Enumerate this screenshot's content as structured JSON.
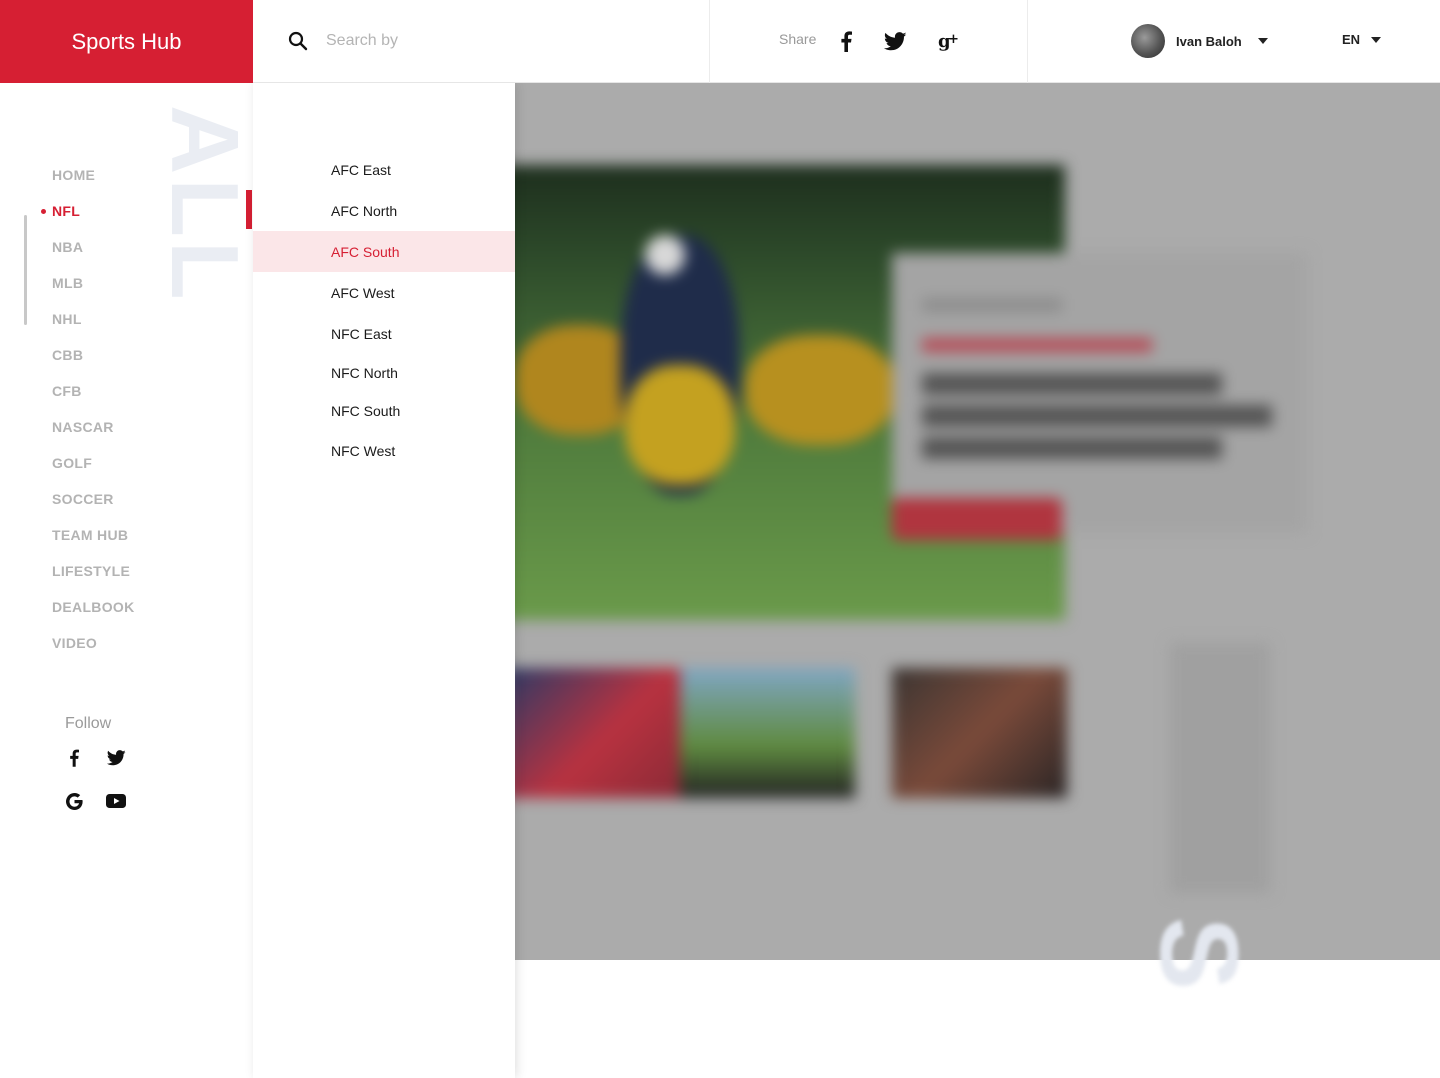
{
  "app": {
    "title": "Sports Hub"
  },
  "search": {
    "placeholder": "Search by"
  },
  "share": {
    "label": "Share",
    "icons": [
      "facebook-icon",
      "twitter-icon",
      "google-plus-icon"
    ]
  },
  "user": {
    "name": "Ivan Baloh"
  },
  "language": {
    "selected": "EN"
  },
  "sidebar": {
    "vertical_word": "ALL",
    "items": [
      {
        "label": "HOME",
        "active": false
      },
      {
        "label": "NFL",
        "active": true
      },
      {
        "label": "NBA",
        "active": false
      },
      {
        "label": "MLB",
        "active": false
      },
      {
        "label": "NHL",
        "active": false
      },
      {
        "label": "CBB",
        "active": false
      },
      {
        "label": "CFB",
        "active": false
      },
      {
        "label": "NASCAR",
        "active": false
      },
      {
        "label": "GOLF",
        "active": false
      },
      {
        "label": "SOCCER",
        "active": false
      },
      {
        "label": "TEAM HUB",
        "active": false
      },
      {
        "label": "LIFESTYLE",
        "active": false
      },
      {
        "label": "DEALBOOK",
        "active": false
      },
      {
        "label": "VIDEO",
        "active": false
      }
    ],
    "follow": {
      "label": "Follow",
      "icons": [
        "facebook-icon",
        "twitter-icon",
        "google-icon",
        "youtube-icon"
      ]
    }
  },
  "submenu": {
    "items": [
      {
        "label": "AFC East",
        "highlighted": false
      },
      {
        "label": "AFC North",
        "highlighted": false
      },
      {
        "label": "AFC South",
        "highlighted": true
      },
      {
        "label": "AFC West",
        "highlighted": false
      },
      {
        "label": "NFC East",
        "highlighted": false
      },
      {
        "label": "NFC North",
        "highlighted": false
      },
      {
        "label": "NFC South",
        "highlighted": false
      },
      {
        "label": "NFC West",
        "highlighted": false
      }
    ]
  },
  "colors": {
    "brand_red": "#d61f33",
    "highlight_bg": "#fbe6e8",
    "overlay_gray": "#ababab",
    "muted_text": "#b3b3b3"
  }
}
